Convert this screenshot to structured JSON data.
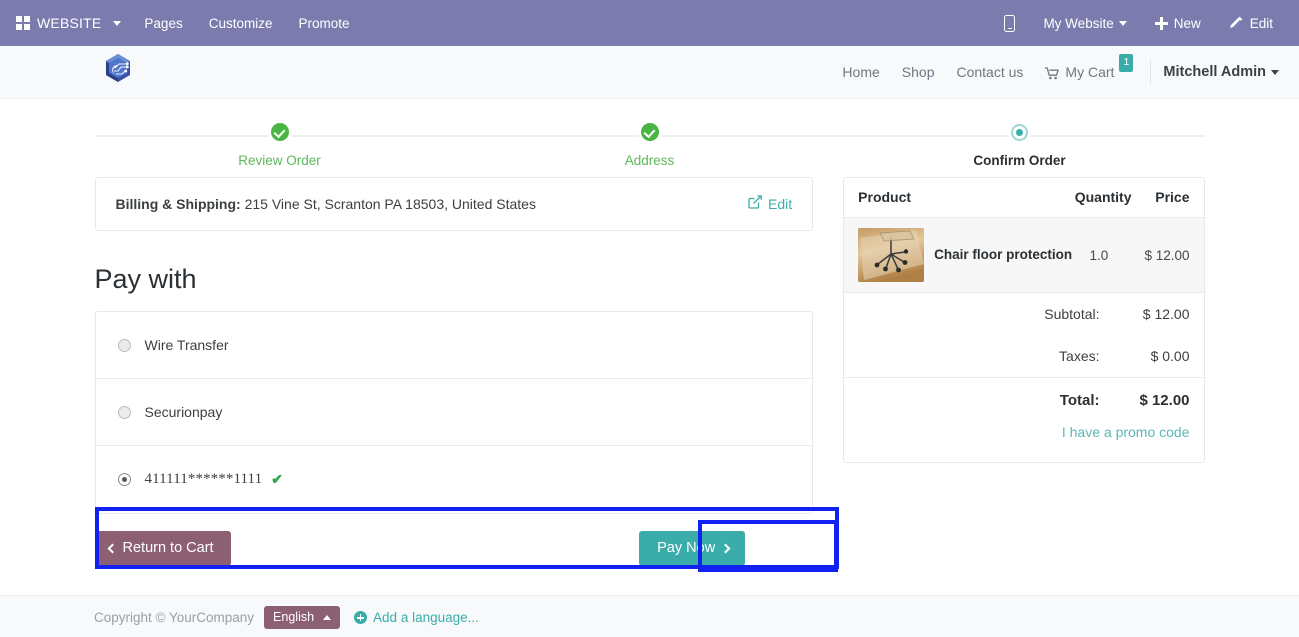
{
  "backend_navbar": {
    "brand": "WEBSITE",
    "menu": [
      {
        "label": "Pages"
      },
      {
        "label": "Customize"
      },
      {
        "label": "Promote"
      }
    ],
    "right": {
      "mobile_preview_icon": "mobile-icon",
      "website_selector": "My Website",
      "new_label": "New",
      "edit_label": "Edit"
    }
  },
  "site_header": {
    "logo_alt": "company-logo",
    "nav": [
      {
        "label": "Home"
      },
      {
        "label": "Shop"
      },
      {
        "label": "Contact us"
      }
    ],
    "cart": {
      "label": "My Cart",
      "count": "1"
    },
    "user": "Mitchell Admin"
  },
  "wizard": {
    "steps": [
      {
        "label": "Review Order",
        "state": "done"
      },
      {
        "label": "Address",
        "state": "done"
      },
      {
        "label": "Confirm Order",
        "state": "current"
      }
    ]
  },
  "address": {
    "label": "Billing & Shipping:",
    "value": "215 Vine St, Scranton PA 18503, United States",
    "edit_label": "Edit"
  },
  "payment": {
    "heading": "Pay with",
    "methods": [
      {
        "label": "Wire Transfer",
        "selected": false
      },
      {
        "label": "Securionpay",
        "selected": false
      },
      {
        "label": "411111******1111",
        "selected": true,
        "verified": "✔"
      }
    ]
  },
  "actions": {
    "return_label": "Return to Cart",
    "pay_label": "Pay Now"
  },
  "summary": {
    "headers": {
      "product": "Product",
      "quantity": "Quantity",
      "price": "Price"
    },
    "items": [
      {
        "name": "Chair floor protection",
        "quantity": "1.0",
        "price": "$ 12.00",
        "thumb_alt": "chair-floor-mat-photo"
      }
    ],
    "subtotal_label": "Subtotal:",
    "subtotal_value": "$ 12.00",
    "taxes_label": "Taxes:",
    "taxes_value": "$ 0.00",
    "total_label": "Total:",
    "total_value": "$ 12.00",
    "promo_label": "I have a promo code"
  },
  "footer": {
    "copyright": "Copyright © YourCompany",
    "language": "English",
    "add_language": "Add a language..."
  },
  "colors": {
    "backend_bar": "#7c7bad",
    "accent_teal": "#3aadaa",
    "success_green": "#4bb543",
    "return_maroon": "#8c5f73",
    "highlight_blue": "#1021f0"
  }
}
